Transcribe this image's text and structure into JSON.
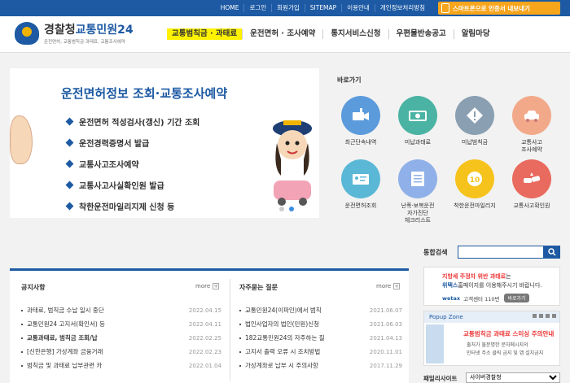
{
  "topnav": [
    "HOME",
    "로그인",
    "회원가입",
    "SITEMAP",
    "이용안내",
    "개인정보처리방침"
  ],
  "mobile_button": "스마트폰으로 인증서 내보내기",
  "logo": {
    "name_a": "경찰청",
    "name_b": "교통민원24",
    "sub": "운전면허, 교통범칙금·과태료, 교통조사예약"
  },
  "gnb": [
    "교통범칙금 · 과태료",
    "운전면허 · 조사예약",
    "통지서비스신청",
    "우편물반송공고",
    "알림마당"
  ],
  "banner": {
    "title": "운전면허정보 조회·교통조사예약",
    "items": [
      "운전면허 적성검사(갱신) 기간 조회",
      "운전경력증명서 발급",
      "교통사고조사예약",
      "교통사고사실확인원 발급",
      "착한운전마일리지제 신청 등"
    ]
  },
  "quick": {
    "title": "바로가기",
    "items": [
      {
        "label": "최근단속내역",
        "color": "#5b9bdc",
        "icon": "camera-icon"
      },
      {
        "label": "미납과태료",
        "color": "#4ab3a3",
        "icon": "money-icon"
      },
      {
        "label": "미납범칙금",
        "color": "#8aa0b2",
        "icon": "warning-icon"
      },
      {
        "label": "교통사고\n조사예약",
        "color": "#f2a98a",
        "icon": "car-icon"
      },
      {
        "label": "운전면허조회",
        "color": "#5ab8d6",
        "icon": "license-icon"
      },
      {
        "label": "난폭·보복운전\n자가진단\n체크리스트",
        "color": "#8fb0e8",
        "icon": "checklist-icon"
      },
      {
        "label": "착한운전마일리지",
        "color": "#f6c31c",
        "icon": "mileage-icon"
      },
      {
        "label": "교통사고확인원",
        "color": "#e96a5e",
        "icon": "accident-icon"
      }
    ]
  },
  "notice": {
    "title": "공지사항",
    "more": "more",
    "rows": [
      {
        "text": "과태료, 범칙금 수납 일시 중단",
        "date": "2022.04.15",
        "bold": false
      },
      {
        "text": "교통민원24 고지서(확인서) 등",
        "date": "2022.04.11",
        "bold": false
      },
      {
        "text": "교통과태료, 범칙금 조회/납",
        "date": "2022.02.25",
        "bold": true
      },
      {
        "text": "[신한은행] 가상계좌 금융거래",
        "date": "2022.02.23",
        "bold": false
      },
      {
        "text": "범칙금 및 과태료 납부관련 카",
        "date": "2022.01.04",
        "bold": false
      }
    ]
  },
  "faq": {
    "title": "자주묻는 질문",
    "more": "more",
    "rows": [
      {
        "text": "교통민원24(이파인)에서 범칙",
        "date": "2021.06.07"
      },
      {
        "text": "법인사업자의 법인(민원)신청",
        "date": "2021.06.03"
      },
      {
        "text": "182교통민원24의 자주하는 질",
        "date": "2021.04.13"
      },
      {
        "text": "고지서 출력 오류 시 조치방법",
        "date": "2020.11.01"
      },
      {
        "text": "가상계좌로 납부 시 주의사항",
        "date": "2017.11.29"
      }
    ]
  },
  "search": {
    "title": "통합검색",
    "placeholder": ""
  },
  "ad": {
    "line1_red": "지방세 주정차 위반 과태료",
    "line1_rest": "는",
    "line2_brand": "위택스",
    "line2_rest": "홈페이지를 이용해주시기 바랍니다.",
    "brand": "wetax",
    "phone": "고객센터 110번",
    "pill": "바로가기"
  },
  "popup": {
    "title": "Popup Zone",
    "t1": "교통범칙금 과태료 스미싱 주의안내",
    "t2": "출처가 불분명한 문자메시지의",
    "t3": "인터넷 주소 클릭 금지 및 앱 설치금지"
  },
  "family": {
    "label": "패밀리사이트",
    "selected": "사이버경찰청"
  },
  "colors": {
    "primary": "#1d5aa3",
    "accent": "#f7a51c",
    "highlight": "#fff200"
  }
}
